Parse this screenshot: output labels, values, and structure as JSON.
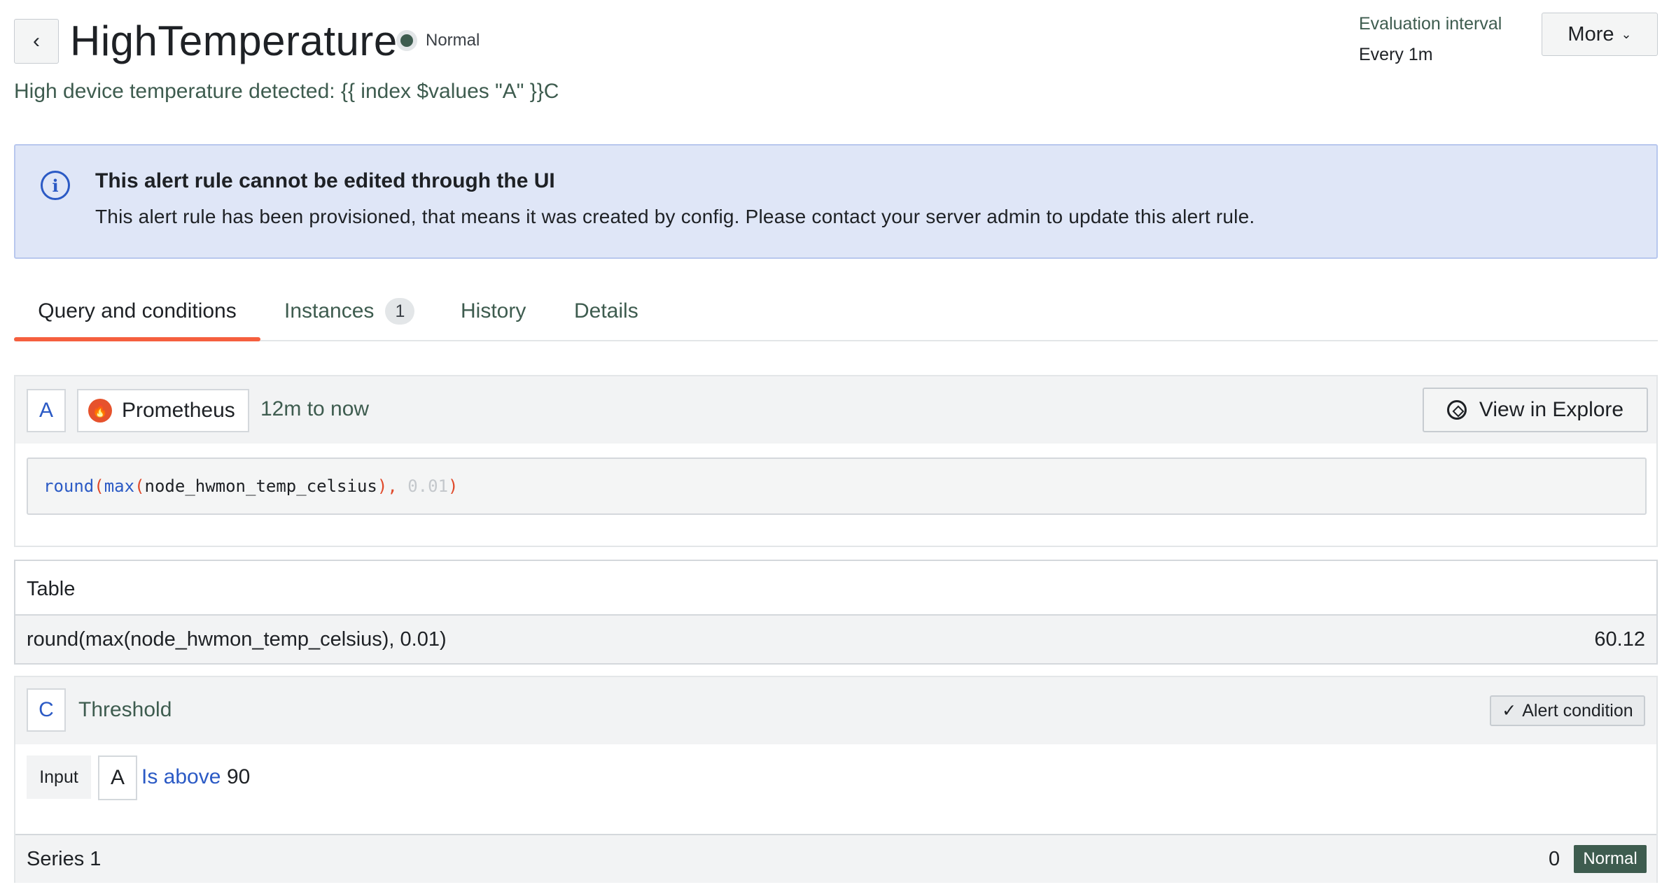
{
  "header": {
    "back_glyph": "‹",
    "title": "HighTemperature",
    "state": "Normal",
    "summary": "High device temperature detected: {{ index $values \"A\" }}C",
    "evaluation_label": "Evaluation interval",
    "evaluation_value": "Every 1m",
    "more_label": "More",
    "more_chevron": "⌄"
  },
  "info_alert": {
    "title": "This alert rule cannot be edited through the UI",
    "text": "This alert rule has been provisioned, that means it was created by config. Please contact your server admin to update this alert rule."
  },
  "tabs": [
    {
      "label": "Query and conditions",
      "active": true
    },
    {
      "label": "Instances",
      "count": "1"
    },
    {
      "label": "History"
    },
    {
      "label": "Details"
    }
  ],
  "query": {
    "ref_id": "A",
    "datasource": "Prometheus",
    "time_range": "12m to now",
    "explore_label": "View in Explore",
    "code": {
      "fn1": "round",
      "open1": "(",
      "fn2": "max",
      "open2": "(",
      "metric": "node_hwmon_temp_celsius",
      "close2": ")",
      "comma": ", ",
      "num": "0.01",
      "close1": ")"
    }
  },
  "table": {
    "title": "Table",
    "rows": [
      {
        "name": "round(max(node_hwmon_temp_celsius), 0.01)",
        "value": "60.12"
      }
    ]
  },
  "threshold": {
    "ref_id": "C",
    "label": "Threshold",
    "alert_condition": "Alert condition",
    "check_glyph": "✓",
    "input_label": "Input",
    "input_ref": "A",
    "operator": "Is above",
    "value": "90",
    "series": [
      {
        "name": "Series 1",
        "value": "0",
        "state": "Normal"
      }
    ]
  },
  "colors": {
    "accent": "#f55f3e",
    "link_blue": "#2b5ac5",
    "normal_green": "#3e5c4f",
    "info_bg": "#dfe6f7"
  }
}
